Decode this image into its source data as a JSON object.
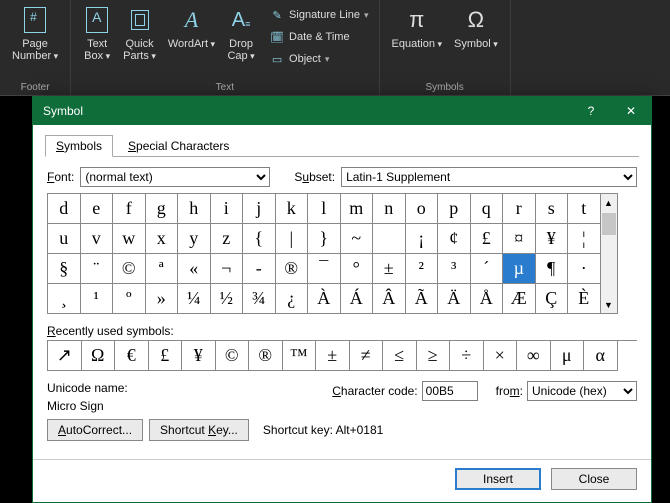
{
  "ribbon": {
    "groups": {
      "footer": {
        "name": "Footer",
        "page_number": "Page\nNumber"
      },
      "text": {
        "name": "Text",
        "text_box": "Text\nBox",
        "quick_parts": "Quick\nParts",
        "wordart": "WordArt",
        "drop_cap": "Drop\nCap",
        "signature": "Signature Line",
        "datetime": "Date & Time",
        "object": "Object"
      },
      "symbols": {
        "name": "Symbols",
        "equation": "Equation",
        "symbol": "Symbol"
      }
    }
  },
  "dialog": {
    "title": "Symbol",
    "help": "?",
    "close": "✕",
    "tabs": {
      "symbols": "Symbols",
      "special": "Special Characters"
    },
    "font_label": "Font:",
    "font_value": "(normal text)",
    "subset_label": "Subset:",
    "subset_value": "Latin-1 Supplement",
    "grid": [
      "d",
      "e",
      "f",
      "g",
      "h",
      "i",
      "j",
      "k",
      "l",
      "m",
      "n",
      "o",
      "p",
      "q",
      "r",
      "s",
      "t",
      "u",
      "v",
      "w",
      "x",
      "y",
      "z",
      "{",
      "|",
      "}",
      "~",
      "",
      "¡",
      "¢",
      "£",
      "¤",
      "¥",
      "¦",
      "§",
      "¨",
      "©",
      "ª",
      "«",
      "¬",
      "-",
      "®",
      "¯",
      "°",
      "±",
      "²",
      "³",
      "´",
      "µ",
      "¶",
      "·",
      "¸",
      "¹",
      "º",
      "»",
      "¼",
      "½",
      "¾",
      "¿",
      "À",
      "Á",
      "Â",
      "Ã",
      "Ä",
      "Å",
      "Æ",
      "Ç",
      "È"
    ],
    "cols": 17,
    "selected_index": 48,
    "recent_label": "Recently used symbols:",
    "recent": [
      "↗",
      "Ω",
      "€",
      "£",
      "¥",
      "©",
      "®",
      "™",
      "±",
      "≠",
      "≤",
      "≥",
      "÷",
      "×",
      "∞",
      "μ",
      "α"
    ],
    "recent_cols": 17,
    "unicode_name_label": "Unicode name:",
    "unicode_name_value": "Micro Sign",
    "char_code_label": "Character code:",
    "char_code_value": "00B5",
    "from_label": "from:",
    "from_value": "Unicode (hex)",
    "autocorrect_btn": "AutoCorrect...",
    "shortcut_btn": "Shortcut Key...",
    "shortcut_label": "Shortcut key: Alt+0181",
    "insert_btn": "Insert",
    "close_btn": "Close"
  }
}
